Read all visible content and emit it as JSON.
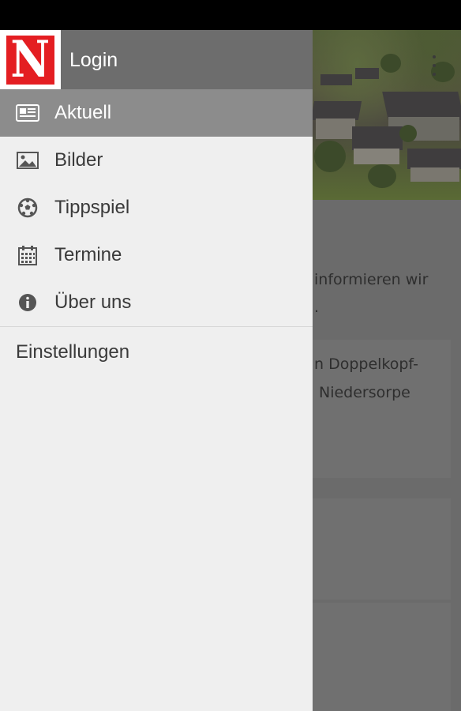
{
  "header": {
    "logo_icon": "newspaper-logo",
    "login_label": "Login"
  },
  "menu": {
    "items": [
      {
        "label": "Aktuell",
        "icon": "newspaper-icon",
        "active": true
      },
      {
        "label": "Bilder",
        "icon": "image-icon",
        "active": false
      },
      {
        "label": "Tippspiel",
        "icon": "soccer-ball-icon",
        "active": false
      },
      {
        "label": "Termine",
        "icon": "calendar-icon",
        "active": false
      },
      {
        "label": "Über uns",
        "icon": "info-icon",
        "active": false
      }
    ],
    "settings_label": "Einstellungen"
  },
  "background": {
    "text_line1": "informieren wir",
    "text_line2": ".",
    "card_text1": "n Doppelkopf-",
    "card_text2": "Niedersorpe"
  },
  "colors": {
    "logo_red": "#e41e22",
    "active_item": "#8c8c8c",
    "header_bg": "#6d6d6d"
  }
}
